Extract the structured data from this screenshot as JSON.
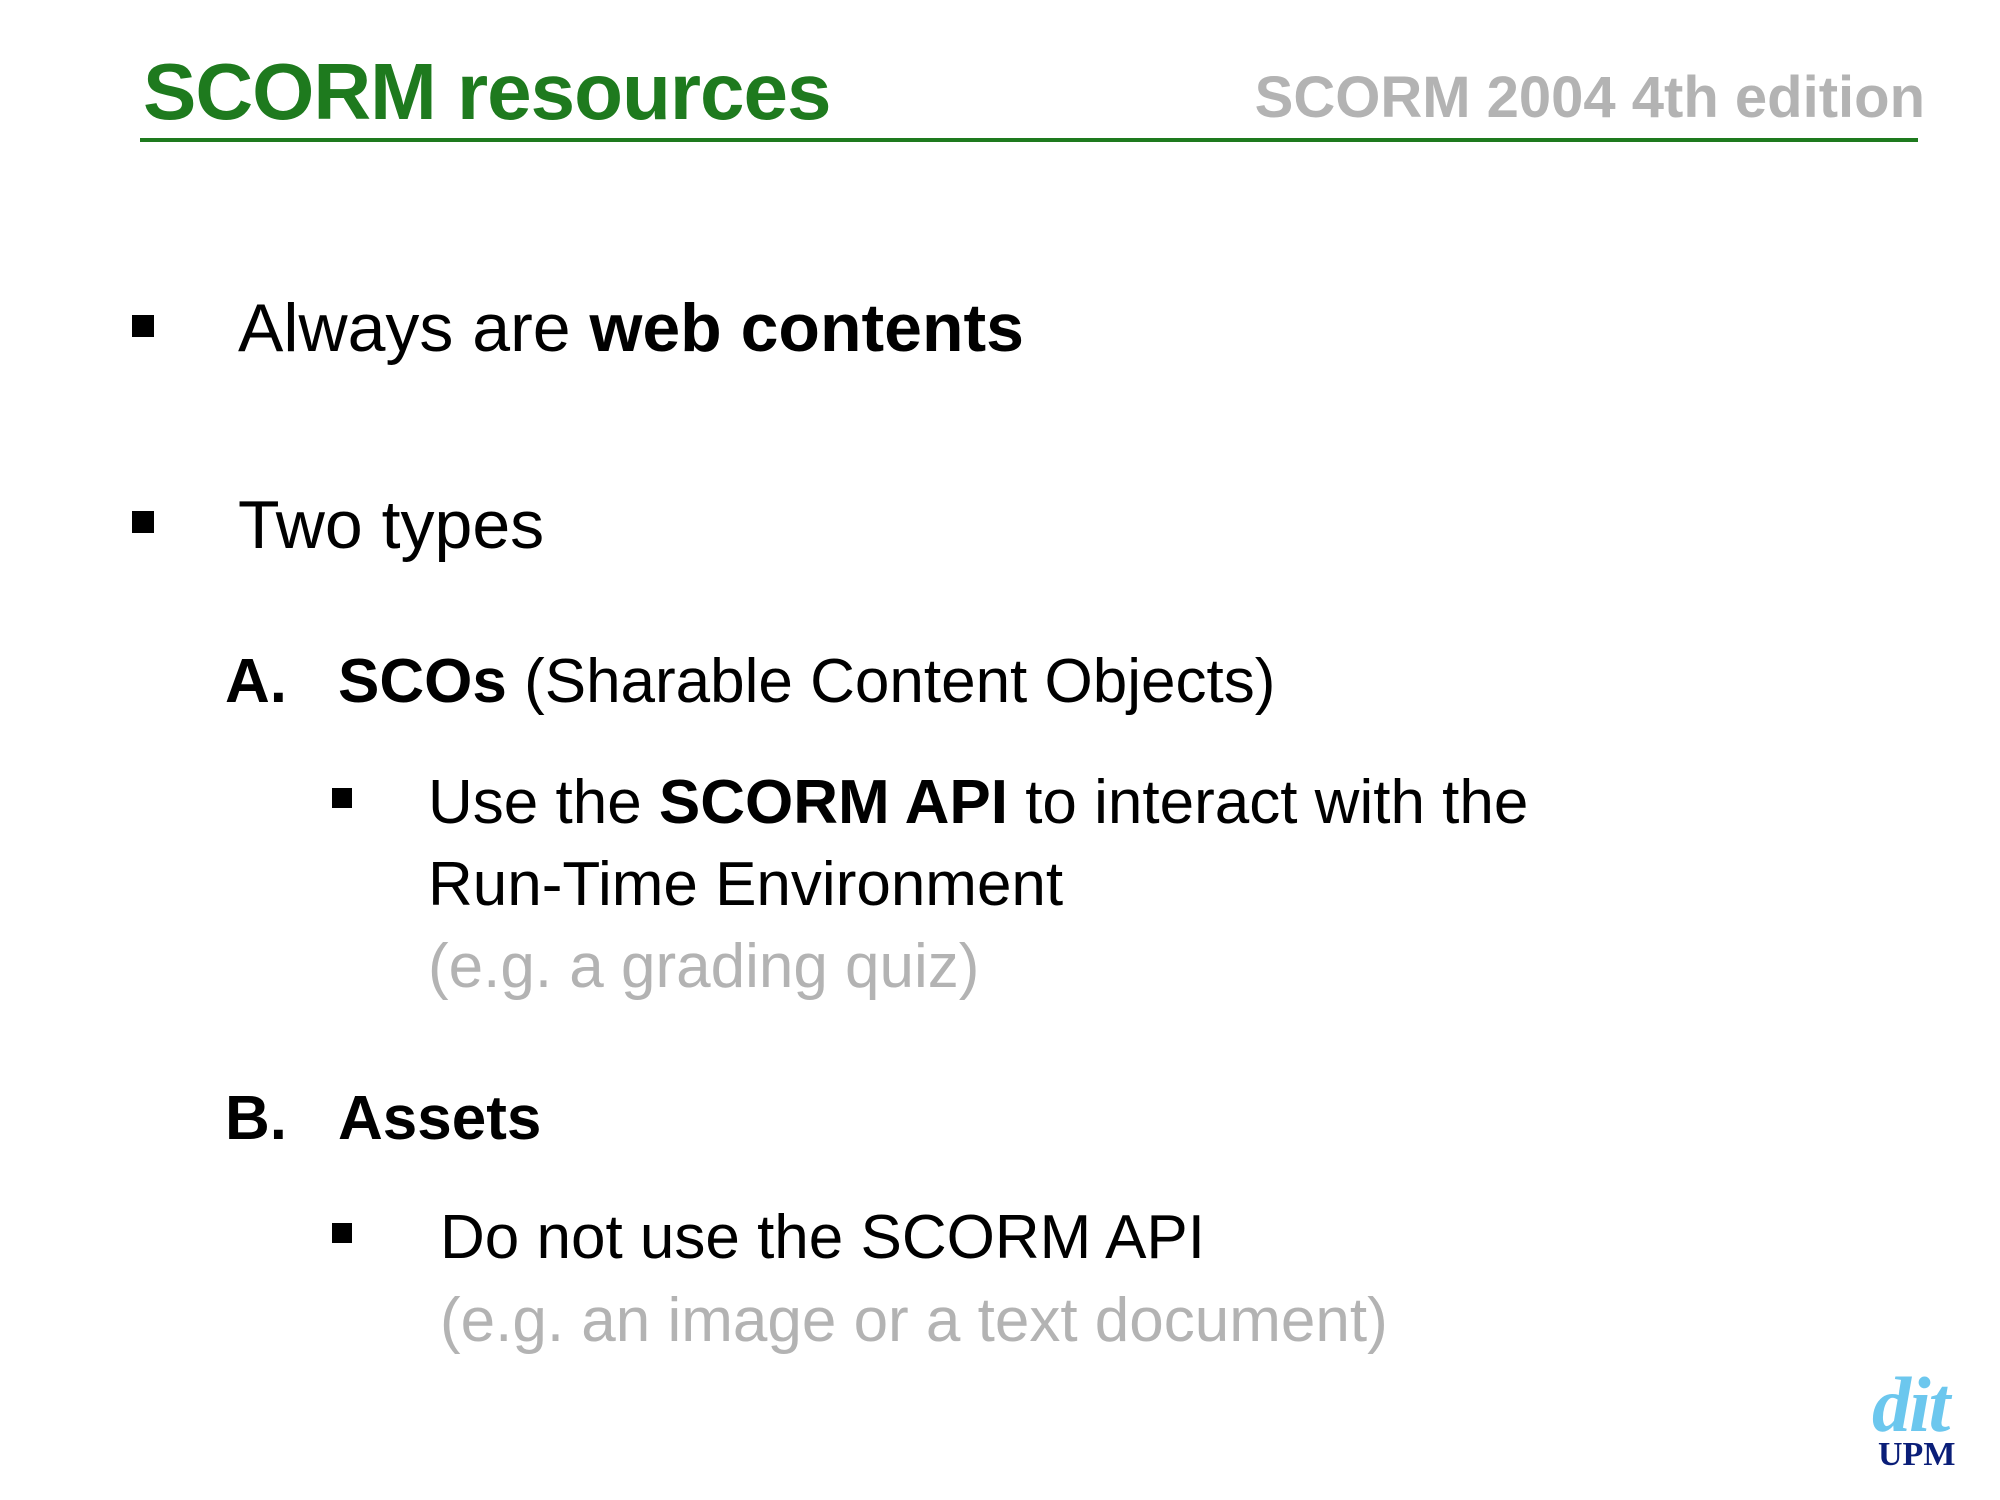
{
  "header": {
    "title": "SCORM resources",
    "subtitle": "SCORM 2004 4th edition"
  },
  "bullets": {
    "b1_prefix": "Always are ",
    "b1_bold": "web contents",
    "b2": "Two types"
  },
  "section_a": {
    "marker": "A.",
    "bold": "SCOs",
    "rest": " (Sharable Content Objects)",
    "item_pre": "Use the ",
    "item_bold": "SCORM API",
    "item_post": " to interact with the",
    "item_line2": "Run-Time Environment",
    "example": "(e.g. a grading quiz)"
  },
  "section_b": {
    "marker": "B.",
    "bold": "Assets",
    "item": "Do not use the SCORM API",
    "example": "(e.g. an image or a text document)"
  },
  "logo": {
    "top": "dit",
    "bottom": "UPM"
  },
  "colors": {
    "title": "#1e7a1e",
    "subtitle": "#b3b3b3",
    "logo_top": "#6cc7ee",
    "logo_bottom": "#0a1e78"
  }
}
